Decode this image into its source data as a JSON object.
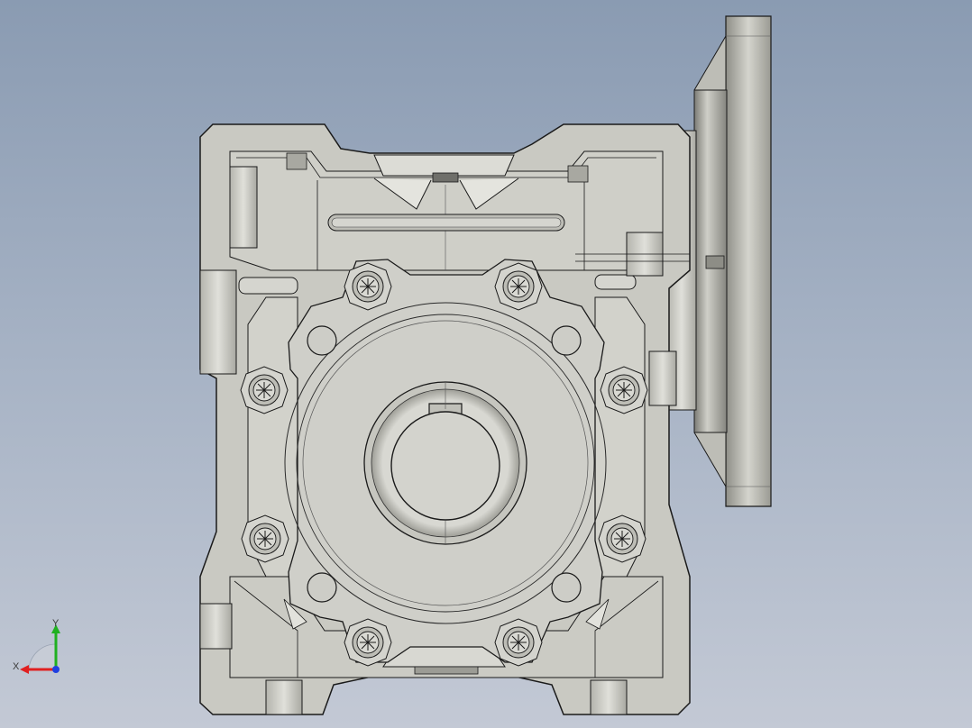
{
  "viewport": {
    "background_top": "#8a9bb2",
    "background_bottom": "#c3c9d5"
  },
  "model": {
    "body_color": "#c9c9c2",
    "edge_color": "#1a1a1a",
    "shade_color": "#8d8d86",
    "highlight_color": "#e8e8e2"
  },
  "triad": {
    "x_label": "X",
    "y_label": "Y",
    "x_color": "#e02020",
    "y_color": "#20b020",
    "z_color": "#2040e0"
  }
}
